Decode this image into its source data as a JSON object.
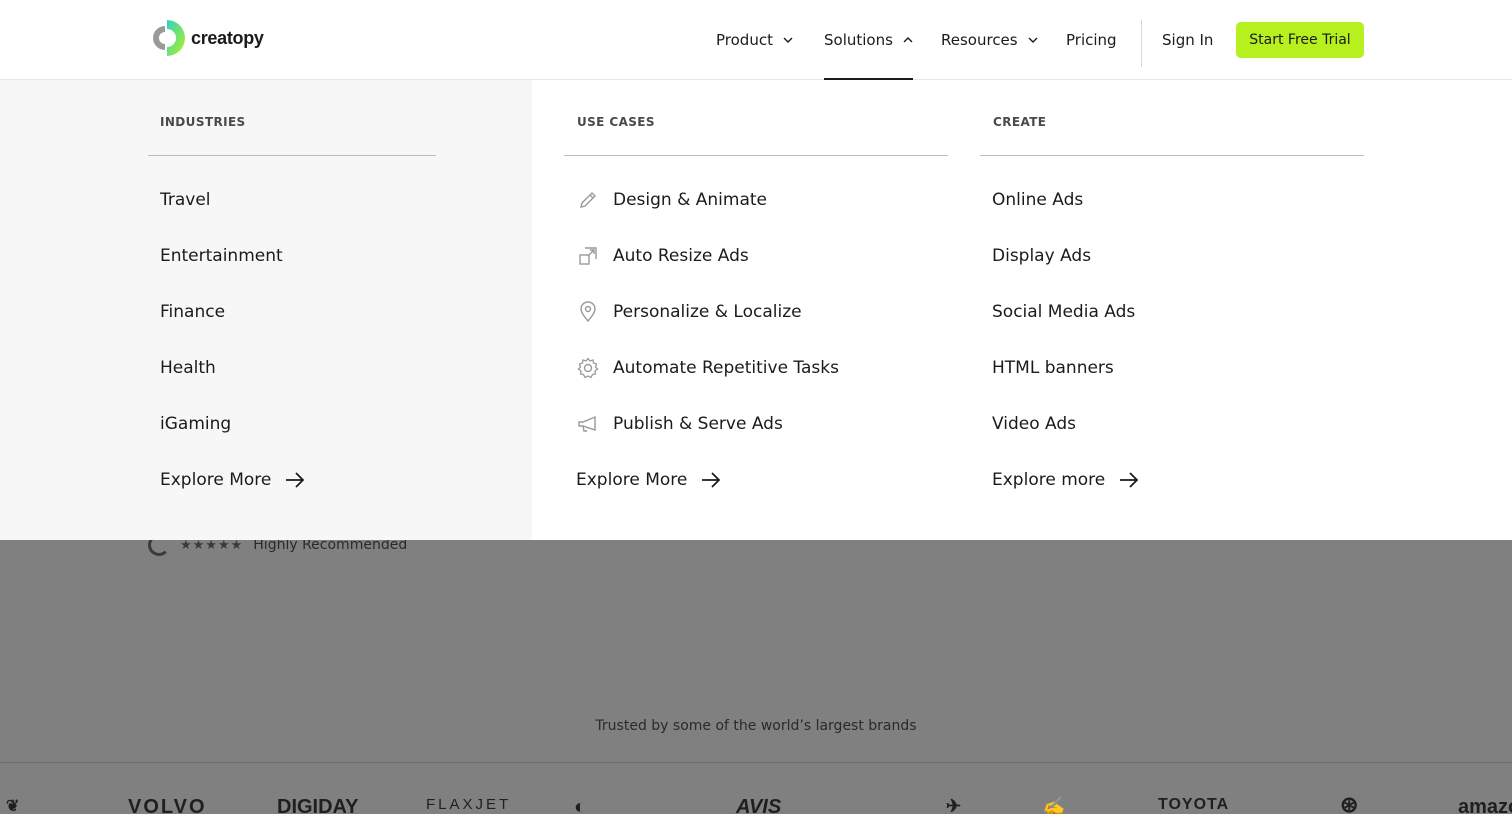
{
  "header": {
    "logo_text": "creatopy",
    "nav": [
      {
        "label": "Product"
      },
      {
        "label": "Solutions"
      },
      {
        "label": "Resources"
      },
      {
        "label": "Pricing"
      }
    ],
    "sign_in": "Sign In",
    "cta": "Start Free Trial",
    "accent_color": "#b6f01f"
  },
  "menu": {
    "industries": {
      "heading": "INDUSTRIES",
      "items": [
        "Travel",
        "Entertainment",
        "Finance",
        "Health",
        "iGaming"
      ],
      "explore": "Explore More"
    },
    "use_cases": {
      "heading": "USE CASES",
      "items": [
        {
          "label": "Design & Animate",
          "icon": "pencil-icon"
        },
        {
          "label": "Auto Resize Ads",
          "icon": "resize-icon"
        },
        {
          "label": "Personalize & Localize",
          "icon": "location-pin-icon"
        },
        {
          "label": "Automate Repetitive Tasks",
          "icon": "gear-icon"
        },
        {
          "label": "Publish & Serve Ads",
          "icon": "megaphone-icon"
        }
      ],
      "explore": "Explore More"
    },
    "create": {
      "heading": "CREATE",
      "items": [
        "Online Ads",
        "Display Ads",
        "Social Media Ads",
        "HTML banners",
        "Video Ads"
      ],
      "explore": "Explore more"
    }
  },
  "background": {
    "rating_text": "Highly Recommended",
    "trusted_text": "Trusted by some of the world’s largest brands",
    "brands": [
      "VOLVO",
      "DIGIDAY",
      "FLAXJET",
      "AVIS",
      "TOYOTA",
      "amazon"
    ]
  }
}
